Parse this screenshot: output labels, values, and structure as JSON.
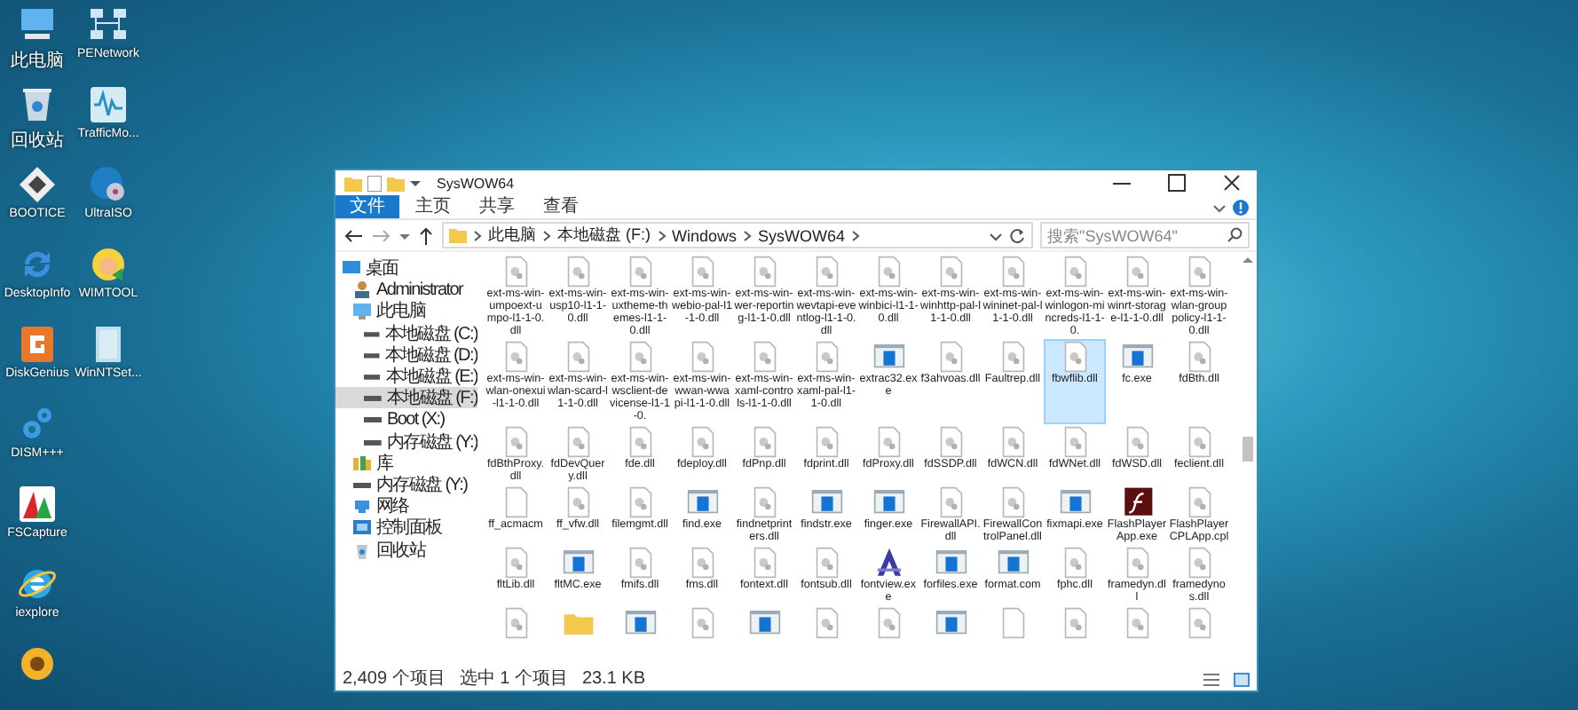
{
  "desktop_icons": [
    {
      "kind": "pc",
      "label": "此电脑"
    },
    {
      "kind": "recycle",
      "label": "回收站"
    },
    {
      "kind": "bootice",
      "label": "BOOTICE"
    },
    {
      "kind": "refresh",
      "label": "DesktopInfo"
    },
    {
      "kind": "diskgenius",
      "label": "DiskGenius"
    },
    {
      "kind": "gears",
      "label": "DISM+++"
    },
    {
      "kind": "fscapture",
      "label": "FSCapture"
    },
    {
      "kind": "ie",
      "label": "iexplore"
    },
    {
      "kind": "flower"
    },
    {
      "kind": "network",
      "label": "PENetwork"
    },
    {
      "kind": "wave",
      "label": "TrafficMo..."
    },
    {
      "kind": "disc",
      "label": "UltraISO"
    },
    {
      "kind": "wimtool",
      "label": "WIMTOOL"
    },
    {
      "kind": "setup",
      "label": "WinNTSet..."
    }
  ],
  "window": {
    "title": "SysWOW64",
    "ribbon_tabs": [
      {
        "kind": "menu",
        "label": "文件"
      },
      {
        "kind": "tab",
        "label": "主页"
      },
      {
        "kind": "tab",
        "label": "共享"
      },
      {
        "kind": "tab",
        "label": "查看"
      }
    ],
    "breadcrumb": [
      "此电脑",
      "本地磁盘 (F:)",
      "Windows",
      "SysWOW64"
    ],
    "search": {
      "placeholder": "搜索\"SysWOW64\""
    },
    "sidebar": [
      {
        "kind": "desktop",
        "label": "桌面",
        "selected": false,
        "children": [
          {
            "kind": "user",
            "label": "Administrator",
            "selected": false
          },
          {
            "kind": "pc",
            "label": "此电脑",
            "selected": false,
            "children": [
              {
                "kind": "drive",
                "label": "本地磁盘 (C:)",
                "selected": false
              },
              {
                "kind": "drive",
                "label": "本地磁盘 (D:)",
                "selected": false
              },
              {
                "kind": "drive",
                "label": "本地磁盘 (E:)",
                "selected": false
              },
              {
                "kind": "drive",
                "label": "本地磁盘 (F:)",
                "selected": true
              },
              {
                "kind": "drive",
                "label": "Boot (X:)",
                "selected": false
              },
              {
                "kind": "drive",
                "label": "内存磁盘 (Y:)",
                "selected": false
              }
            ]
          },
          {
            "kind": "library",
            "label": "库",
            "selected": false
          },
          {
            "kind": "drive",
            "label": "内存磁盘 (Y:)",
            "selected": false
          },
          {
            "kind": "network",
            "label": "网络",
            "selected": false
          },
          {
            "kind": "control",
            "label": "控制面板",
            "selected": false
          },
          {
            "kind": "recycle",
            "label": "回收站",
            "selected": false
          }
        ]
      }
    ],
    "files": [
      {
        "kind": "dll",
        "name": "ext-ms-win-umpoext-umpo-l1-1-0.dll",
        "selected": false
      },
      {
        "kind": "dll",
        "name": "ext-ms-win-usp10-l1-1-0.dll",
        "selected": false
      },
      {
        "kind": "dll",
        "name": "ext-ms-win-uxtheme-themes-l1-1-0.dll",
        "selected": false
      },
      {
        "kind": "dll",
        "name": "ext-ms-win-webio-pal-l1-1-0.dll",
        "selected": false
      },
      {
        "kind": "dll",
        "name": "ext-ms-win-wer-reporting-l1-1-0.dll",
        "selected": false
      },
      {
        "kind": "dll",
        "name": "ext-ms-win-wevtapi-eventlog-l1-1-0.dll",
        "selected": false
      },
      {
        "kind": "dll",
        "name": "ext-ms-win-winbici-l1-1-0.dll",
        "selected": false
      },
      {
        "kind": "dll",
        "name": "ext-ms-win-winhttp-pal-l1-1-0.dll",
        "selected": false
      },
      {
        "kind": "dll",
        "name": "ext-ms-win-wininet-pal-l1-1-0.dll",
        "selected": false
      },
      {
        "kind": "dll",
        "name": "ext-ms-win-winlogon-mincreds-l1-1-0.",
        "selected": false
      },
      {
        "kind": "dll",
        "name": "ext-ms-win-winrt-storage-l1-1-0.dll",
        "selected": false
      },
      {
        "kind": "dll",
        "name": "ext-ms-win-wlan-grouppolicy-l1-1-0.dll",
        "selected": false
      },
      {
        "kind": "dll",
        "name": "ext-ms-win-wlan-onexui-l1-1-0.dll",
        "selected": false
      },
      {
        "kind": "dll",
        "name": "ext-ms-win-wlan-scard-l1-1-0.dll",
        "selected": false
      },
      {
        "kind": "dll",
        "name": "ext-ms-win-wsclient-devicense-l1-1-0.",
        "selected": false
      },
      {
        "kind": "dll",
        "name": "ext-ms-win-wwan-wwapi-l1-1-0.dll",
        "selected": false
      },
      {
        "kind": "dll",
        "name": "ext-ms-win-xaml-controls-l1-1-0.dll",
        "selected": false
      },
      {
        "kind": "dll",
        "name": "ext-ms-win-xaml-pal-l1-1-0.dll",
        "selected": false
      },
      {
        "kind": "exe",
        "name": "extrac32.exe",
        "selected": false
      },
      {
        "kind": "dll",
        "name": "f3ahvoas.dll",
        "selected": false
      },
      {
        "kind": "dll",
        "name": "Faultrep.dll",
        "selected": false
      },
      {
        "kind": "dll",
        "name": "fbwflib.dll",
        "selected": true
      },
      {
        "kind": "exe",
        "name": "fc.exe",
        "selected": false
      },
      {
        "kind": "dll",
        "name": "fdBth.dll",
        "selected": false
      },
      {
        "kind": "dll",
        "name": "fdBthProxy.dll",
        "selected": false
      },
      {
        "kind": "dll",
        "name": "fdDevQuery.dll",
        "selected": false
      },
      {
        "kind": "dll",
        "name": "fde.dll",
        "selected": false
      },
      {
        "kind": "dll",
        "name": "fdeploy.dll",
        "selected": false
      },
      {
        "kind": "dll",
        "name": "fdPnp.dll",
        "selected": false
      },
      {
        "kind": "dll",
        "name": "fdprint.dll",
        "selected": false
      },
      {
        "kind": "dll",
        "name": "fdProxy.dll",
        "selected": false
      },
      {
        "kind": "dll",
        "name": "fdSSDP.dll",
        "selected": false
      },
      {
        "kind": "dll",
        "name": "fdWCN.dll",
        "selected": false
      },
      {
        "kind": "dll",
        "name": "fdWNet.dll",
        "selected": false
      },
      {
        "kind": "dll",
        "name": "fdWSD.dll",
        "selected": false
      },
      {
        "kind": "dll",
        "name": "feclient.dll",
        "selected": false
      },
      {
        "kind": "blank",
        "name": "ff_acmacm",
        "selected": false
      },
      {
        "kind": "dll",
        "name": "ff_vfw.dll",
        "selected": false
      },
      {
        "kind": "dll",
        "name": "filemgmt.dll",
        "selected": false
      },
      {
        "kind": "exe",
        "name": "find.exe",
        "selected": false
      },
      {
        "kind": "dll",
        "name": "findnetprinters.dll",
        "selected": false
      },
      {
        "kind": "exe",
        "name": "findstr.exe",
        "selected": false
      },
      {
        "kind": "exe",
        "name": "finger.exe",
        "selected": false
      },
      {
        "kind": "dll",
        "name": "FirewallAPI.dll",
        "selected": false
      },
      {
        "kind": "dll",
        "name": "FirewallControlPanel.dll",
        "selected": false
      },
      {
        "kind": "exe",
        "name": "fixmapi.exe",
        "selected": false
      },
      {
        "kind": "flash",
        "name": "FlashPlayerApp.exe",
        "selected": false
      },
      {
        "kind": "dll",
        "name": "FlashPlayerCPLApp.cpl",
        "selected": false
      },
      {
        "kind": "dll",
        "name": "fltLib.dll",
        "selected": false
      },
      {
        "kind": "exe",
        "name": "fltMC.exe",
        "selected": false
      },
      {
        "kind": "dll",
        "name": "fmifs.dll",
        "selected": false
      },
      {
        "kind": "dll",
        "name": "fms.dll",
        "selected": false
      },
      {
        "kind": "dll",
        "name": "fontext.dll",
        "selected": false
      },
      {
        "kind": "dll",
        "name": "fontsub.dll",
        "selected": false
      },
      {
        "kind": "font",
        "name": "fontview.exe",
        "selected": false
      },
      {
        "kind": "exe",
        "name": "forfiles.exe",
        "selected": false
      },
      {
        "kind": "exe",
        "name": "format.com",
        "selected": false
      },
      {
        "kind": "dll",
        "name": "fphc.dll",
        "selected": false
      },
      {
        "kind": "dll",
        "name": "framedyn.dll",
        "selected": false
      },
      {
        "kind": "dll",
        "name": "framedynos.dll",
        "selected": false
      },
      {
        "kind": "dll"
      },
      {
        "kind": "folder"
      },
      {
        "kind": "exe"
      },
      {
        "kind": "dll"
      },
      {
        "kind": "exe"
      },
      {
        "kind": "dll"
      },
      {
        "kind": "dll"
      },
      {
        "kind": "exe"
      },
      {
        "kind": "blank"
      },
      {
        "kind": "dll"
      },
      {
        "kind": "dll"
      },
      {
        "kind": "dll"
      }
    ],
    "status": {
      "count": "2,409 个项目",
      "selection": "选中 1 个项目",
      "size": "23.1 KB"
    }
  }
}
